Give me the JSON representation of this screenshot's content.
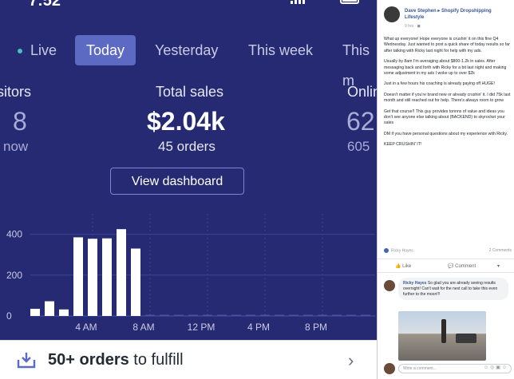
{
  "status_bar": {
    "time": "7:52"
  },
  "tabs": [
    {
      "label": "Live",
      "active": false
    },
    {
      "label": "Today",
      "active": true
    },
    {
      "label": "Yesterday",
      "active": false
    },
    {
      "label": "This week",
      "active": false
    },
    {
      "label": "This m",
      "active": false
    }
  ],
  "kpis": {
    "visitors": {
      "label": "sitors",
      "value": "8",
      "sub": "now"
    },
    "total_sales": {
      "label": "Total sales",
      "value": "$2.04k",
      "sub": "45 orders"
    },
    "online": {
      "label": "Onlin",
      "value": "62",
      "sub": "605"
    }
  },
  "view_dashboard_label": "View dashboard",
  "chart_data": {
    "type": "bar",
    "y_ticks": [
      "0",
      "200",
      "400"
    ],
    "ylim": [
      0,
      500
    ],
    "x_tick_labels": [
      "4 AM",
      "8 AM",
      "12 PM",
      "4 PM",
      "8 PM"
    ],
    "hours": [
      0,
      1,
      2,
      3,
      4,
      5,
      6,
      7,
      8,
      9,
      10,
      11,
      12,
      13,
      14,
      15,
      16,
      17,
      18,
      19,
      20,
      21,
      22,
      23
    ],
    "values": [
      35,
      72,
      32,
      385,
      378,
      380,
      425,
      330,
      0,
      0,
      0,
      0,
      0,
      0,
      0,
      0,
      0,
      0,
      0,
      0,
      0,
      0,
      0,
      0
    ]
  },
  "fulfill": {
    "count": "50+ orders",
    "suffix": " to fulfill"
  },
  "colors": {
    "app_bg": "#262a72",
    "accent": "#5c6ac4",
    "bar": "#ffffff"
  },
  "facebook_post": {
    "author": "Dave Stephen",
    "group": "Shopify Dropshipping Lifestyle",
    "time": "9 hrs",
    "paragraphs": [
      "What up everyone! Hope everyone is crushin' it on this fine Q4 Wednesday. Just wanted to post a quick share of today results so far after talking with Ricky last night for help with my ads.",
      "Usually by 8am I'm averaging about $800-1.2k in sales. After messaging back and forth with Ricky for a bit last night and making some adjustment in my ads I woke up to over $2k",
      "Just in a few hours his coaching is already paying off HUGE!",
      "Doesn't matter if you're brand new or already crushin' it. I did 75k last month and still reached out for help. There's always room to grow",
      "Get that course!! This guy provides tonnns of value and ideas you don't see anyone else talking about (BACKEND) to skyrocket your sales",
      "DM if you have personal questions about my experience with Ricky.",
      "KEEP CRUSHIN' IT!"
    ],
    "reaction_name": "Ricky Hayes",
    "comments_count": "2 Comments",
    "like_label": "Like",
    "comment_label": "Comment",
    "comment": {
      "name": "Ricky Hayes",
      "text": "So glad you are already seeing results overnight! Can't wait for the next call to take this even further to the moon!!!"
    },
    "write_placeholder": "Write a comment..."
  }
}
